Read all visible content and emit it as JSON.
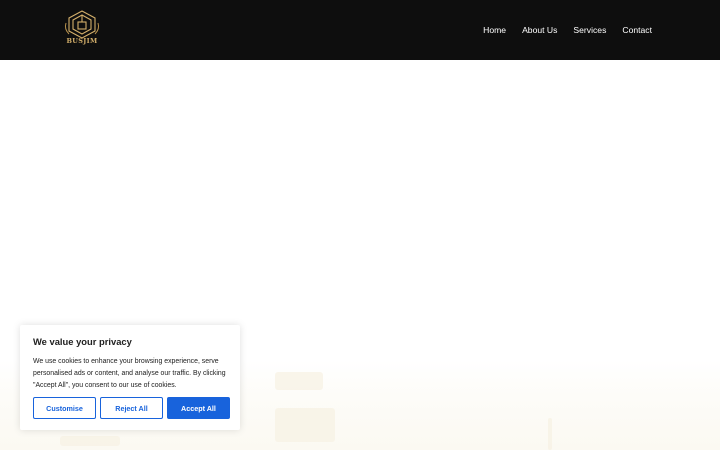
{
  "header": {
    "logo_text": "BUSJIM",
    "background": "#0e0e0e",
    "brand_color": "#d2ae6a"
  },
  "nav": {
    "items": [
      {
        "label": "Home"
      },
      {
        "label": "About Us"
      },
      {
        "label": "Services"
      },
      {
        "label": "Contact"
      }
    ]
  },
  "cookie_banner": {
    "title": "We value your privacy",
    "text": "We use cookies to enhance your browsing experience, serve personalised ads or content, and analyse our traffic. By clicking \"Accept All\", you consent to our use of cookies.",
    "buttons": {
      "customise": "Customise",
      "reject": "Reject All",
      "accept": "Accept All"
    },
    "accent_color": "#1863dc"
  }
}
